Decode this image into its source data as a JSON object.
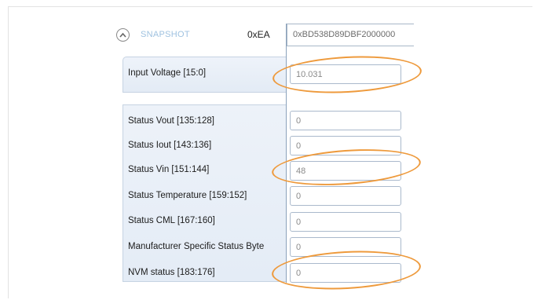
{
  "header": {
    "section_label": "SNAPSHOT",
    "address": "0xEA",
    "hex_value": "0xBD538D89DBF2000000"
  },
  "rows": [
    {
      "label": "Input Voltage [15:0]",
      "value": "10.031"
    },
    {
      "label": "Status Vout [135:128]",
      "value": "0"
    },
    {
      "label": "Status Iout [143:136]",
      "value": "0"
    },
    {
      "label": "Status Vin [151:144]",
      "value": "48"
    },
    {
      "label": "Status Temperature [159:152]",
      "value": "0"
    },
    {
      "label": "Status CML [167:160]",
      "value": "0"
    },
    {
      "label": "Manufacturer Specific Status Byte",
      "value": "0"
    },
    {
      "label": "NVM status [183:176]",
      "value": "0"
    }
  ],
  "colors": {
    "highlight_ring": "#ee9a3c",
    "panel_bg": "#e8eef7",
    "snapshot_text": "#9fc2e0"
  }
}
